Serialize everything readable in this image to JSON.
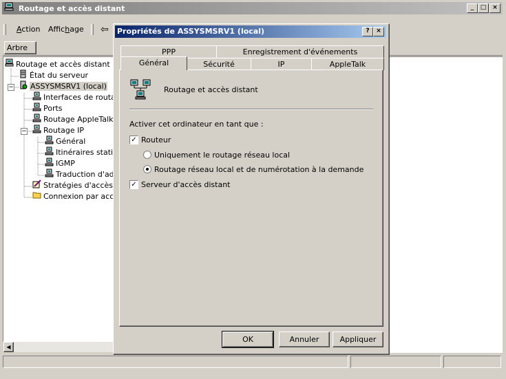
{
  "main_window": {
    "title": "Routage et accès distant",
    "controls": {
      "minimize": "_",
      "maximize": "□",
      "close": "×"
    }
  },
  "menubar": {
    "items": [
      {
        "label": "Action",
        "accel": "A",
        "rest": "ction"
      },
      {
        "label": "Affichage",
        "pre": "Affic",
        "accel": "h",
        "rest": "age"
      }
    ],
    "back_arrow": "⇦"
  },
  "tree_panel": {
    "tab_label": "Arbre",
    "items": [
      {
        "label": "Routage et accès distant",
        "icon": "computer-icon"
      },
      {
        "label": "État du serveur",
        "icon": "server-icon"
      },
      {
        "label": "ASSYSMSRV1 (local)",
        "icon": "server-status-icon"
      },
      {
        "label": "Interfaces de routage",
        "icon": "network-icon"
      },
      {
        "label": "Ports",
        "icon": "network-icon"
      },
      {
        "label": "Routage AppleTalk",
        "icon": "network-icon"
      },
      {
        "label": "Routage IP",
        "icon": "network-icon"
      },
      {
        "label": "Général",
        "icon": "network-icon"
      },
      {
        "label": "Itinéraires statiques",
        "icon": "network-icon"
      },
      {
        "label": "IGMP",
        "icon": "network-icon"
      },
      {
        "label": "Traduction d'adresses",
        "icon": "network-icon"
      },
      {
        "label": "Stratégies d'accès distant",
        "icon": "policy-icon"
      },
      {
        "label": "Connexion par accès distant",
        "icon": "folder-icon"
      }
    ]
  },
  "dialog": {
    "title": "Propriétés de ASSYSMSRV1 (local)",
    "help": "?",
    "close": "×",
    "tabs_row1": [
      "PPP",
      "Enregistrement d'événements"
    ],
    "tabs_row2": [
      "Général",
      "Sécurité",
      "IP",
      "AppleTalk"
    ],
    "header_label": "Routage et accès distant",
    "section_label": "Activer cet ordinateur en tant que :",
    "router_checkbox": {
      "label": "Routeur",
      "checked": true,
      "mark": "✓"
    },
    "radio_local": {
      "label": "Uniquement le routage réseau local",
      "selected": false
    },
    "radio_demand": {
      "label": "Routage réseau local et de numérotation à la demande",
      "selected": true
    },
    "remote_access_checkbox": {
      "label": "Serveur d'accès distant",
      "checked": true,
      "mark": "✓"
    },
    "buttons": {
      "ok": "OK",
      "cancel": "Annuler",
      "apply": "Appliquer"
    }
  }
}
